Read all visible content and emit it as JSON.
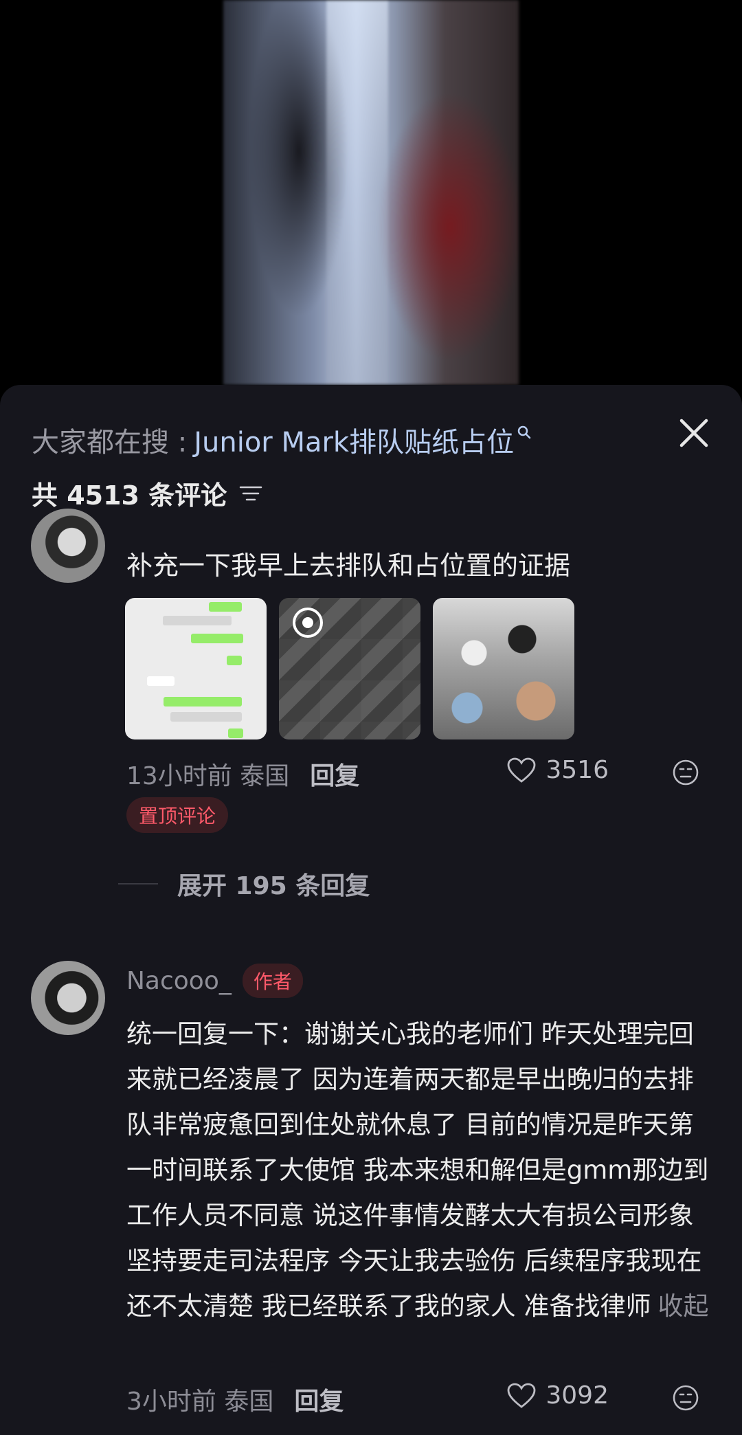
{
  "search": {
    "prefix": "大家都在搜 :",
    "term": "Junior Mark排队贴纸占位"
  },
  "comments_header": {
    "count_text": "共 4513 条评论"
  },
  "comment1": {
    "text": "补充一下我早上去排队和占位置的证据",
    "time_location": "13小时前 泰国",
    "reply_label": "回复",
    "likes": "3516",
    "pinned_label": "置顶评论",
    "expand_label": "展开 195 条回复"
  },
  "comment2": {
    "username": "Nacooo_",
    "author_badge": "作者",
    "text": "统一回复一下：谢谢关心我的老师们 昨天处理完回来就已经凌晨了 因为连着两天都是早出晚归的去排队非常疲惫回到住处就休息了 目前的情况是昨天第一时间联系了大使馆 我本来想和解但是gmm那边到工作人员不同意 说这件事情发酵太大有损公司形象 坚持要走司法程序 今天让我去验伤 后续程序我现在还不太清楚 我已经联系了我的家人 准备找律师",
    "collapse_label": "收起",
    "time_location": "3小时前 泰国",
    "reply_label": "回复",
    "likes": "3092"
  },
  "colors": {
    "panel_bg": "#16161d",
    "search_term": "#b8cdf0",
    "badge_text": "#ff5a6a",
    "badge_bg": "#3a1d22"
  },
  "icons": [
    "search-icon",
    "close-icon",
    "filter-icon",
    "heart-icon",
    "dislike-face-icon",
    "play-icon"
  ]
}
